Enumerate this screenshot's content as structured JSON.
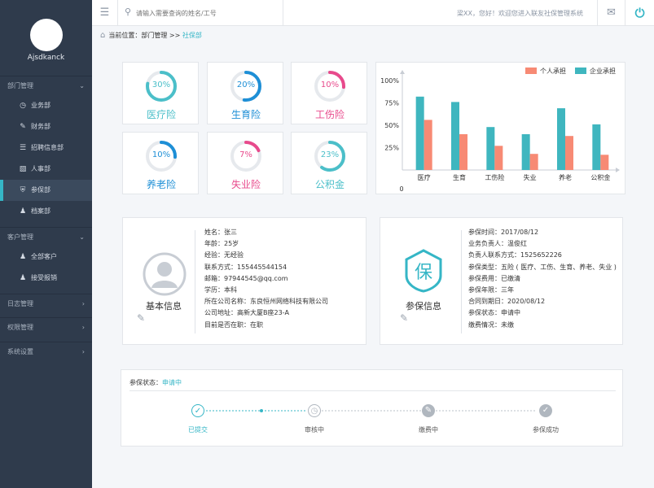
{
  "sidebar": {
    "username": "Ajsdkanck",
    "groups": [
      {
        "label": "部门管理",
        "items": [
          {
            "label": "业务部",
            "icon": "clock-icon"
          },
          {
            "label": "财务部",
            "icon": "edit-icon"
          },
          {
            "label": "招聘信息部",
            "icon": "list-icon"
          },
          {
            "label": "人事部",
            "icon": "person-card-icon"
          },
          {
            "label": "参保部",
            "icon": "shield-icon"
          },
          {
            "label": "档案部",
            "icon": "users-icon"
          }
        ]
      },
      {
        "label": "客户管理",
        "items": [
          {
            "label": "全部客户",
            "icon": "users-icon"
          },
          {
            "label": "接受报销",
            "icon": "users-icon"
          }
        ]
      },
      {
        "label": "日志管理",
        "items": []
      },
      {
        "label": "权限管理",
        "items": []
      },
      {
        "label": "系统设置",
        "items": []
      }
    ]
  },
  "topbar": {
    "search_placeholder": "请输入需要查询的姓名/工号",
    "welcome": "梁XX，您好！欢迎您进入联友社保管理系统"
  },
  "breadcrumb": {
    "prefix": "当前位置：",
    "path": "部门管理 >> ",
    "current": "社保部"
  },
  "insurance_cards": [
    {
      "name": "医疗险",
      "pct": "30%",
      "value": 30,
      "color": "#4bbfc9"
    },
    {
      "name": "生育险",
      "pct": "20%",
      "value": 20,
      "color": "#1e8fd6"
    },
    {
      "name": "工伤险",
      "pct": "10%",
      "value": 10,
      "color": "#e84a8c"
    },
    {
      "name": "养老险",
      "pct": "10%",
      "value": 10,
      "color": "#1e8fd6"
    },
    {
      "name": "失业险",
      "pct": "7%",
      "value": 7,
      "color": "#e84a8c"
    },
    {
      "name": "公积金",
      "pct": "23%",
      "value": 23,
      "color": "#4bbfc9"
    }
  ],
  "chart_data": {
    "type": "bar",
    "categories": [
      "医疗",
      "生育",
      "工伤险",
      "失业",
      "养老",
      "公积金"
    ],
    "series": [
      {
        "name": "企业承担",
        "values": [
          82,
          76,
          48,
          40,
          69,
          51
        ],
        "color": "#3fb6bf"
      },
      {
        "name": "个人承担",
        "values": [
          56,
          40,
          27,
          18,
          38,
          17
        ],
        "color": "#f78a74"
      }
    ],
    "yticks": [
      "100%",
      "75%",
      "50%",
      "25%"
    ],
    "y_zero_label": "0",
    "ylim": [
      0,
      100
    ],
    "legend_position": "top-right",
    "legend_order": [
      "个人承担",
      "企业承担"
    ]
  },
  "basic_info": {
    "title": "基本信息",
    "rows": [
      "姓名：张三",
      "年龄：25岁",
      "经验：无经验",
      "联系方式：155445544154",
      "邮箱：97944545@qq.com",
      "学历：本科",
      "所在公司名称：东良恒州网络科技有限公司",
      "公司地址：高新大厦B座23-A",
      "目前是否在职：在职"
    ]
  },
  "insure_info": {
    "title": "参保信息",
    "emblem": "保",
    "rows": [
      "参保时间：2017/08/12",
      "业务负责人：温俊红",
      "负责人联系方式：1525652226",
      "参保类型：五险 ( 医疗、工伤、生育、养老、失业 )",
      "参保费用：已缴清",
      "参保年限：三年",
      "合同到期日：2020/08/12",
      "参保状态：申请中",
      "缴费情况：未缴"
    ]
  },
  "status": {
    "label": "参保状态：",
    "value": "申请中",
    "steps": [
      {
        "label": "已提交",
        "state": "done",
        "icon": "check-circle-icon"
      },
      {
        "label": "审核中",
        "state": "pending",
        "icon": "clock-icon"
      },
      {
        "label": "缴费中",
        "state": "pending",
        "icon": "edit-icon"
      },
      {
        "label": "参保成功",
        "state": "pending",
        "icon": "check-icon"
      }
    ]
  }
}
